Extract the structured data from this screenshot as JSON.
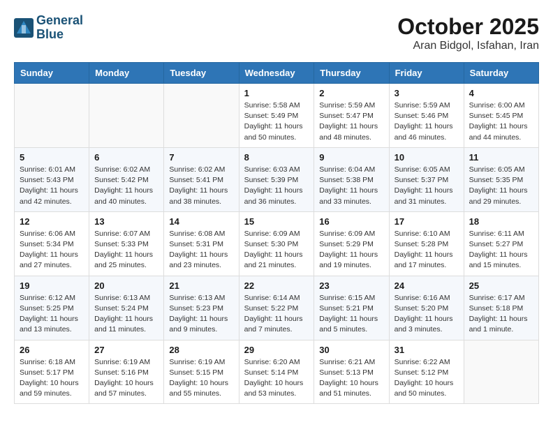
{
  "header": {
    "logo_line1": "General",
    "logo_line2": "Blue",
    "month": "October 2025",
    "location": "Aran Bidgol, Isfahan, Iran"
  },
  "weekdays": [
    "Sunday",
    "Monday",
    "Tuesday",
    "Wednesday",
    "Thursday",
    "Friday",
    "Saturday"
  ],
  "weeks": [
    [
      {
        "day": "",
        "info": ""
      },
      {
        "day": "",
        "info": ""
      },
      {
        "day": "",
        "info": ""
      },
      {
        "day": "1",
        "info": "Sunrise: 5:58 AM\nSunset: 5:49 PM\nDaylight: 11 hours\nand 50 minutes."
      },
      {
        "day": "2",
        "info": "Sunrise: 5:59 AM\nSunset: 5:47 PM\nDaylight: 11 hours\nand 48 minutes."
      },
      {
        "day": "3",
        "info": "Sunrise: 5:59 AM\nSunset: 5:46 PM\nDaylight: 11 hours\nand 46 minutes."
      },
      {
        "day": "4",
        "info": "Sunrise: 6:00 AM\nSunset: 5:45 PM\nDaylight: 11 hours\nand 44 minutes."
      }
    ],
    [
      {
        "day": "5",
        "info": "Sunrise: 6:01 AM\nSunset: 5:43 PM\nDaylight: 11 hours\nand 42 minutes."
      },
      {
        "day": "6",
        "info": "Sunrise: 6:02 AM\nSunset: 5:42 PM\nDaylight: 11 hours\nand 40 minutes."
      },
      {
        "day": "7",
        "info": "Sunrise: 6:02 AM\nSunset: 5:41 PM\nDaylight: 11 hours\nand 38 minutes."
      },
      {
        "day": "8",
        "info": "Sunrise: 6:03 AM\nSunset: 5:39 PM\nDaylight: 11 hours\nand 36 minutes."
      },
      {
        "day": "9",
        "info": "Sunrise: 6:04 AM\nSunset: 5:38 PM\nDaylight: 11 hours\nand 33 minutes."
      },
      {
        "day": "10",
        "info": "Sunrise: 6:05 AM\nSunset: 5:37 PM\nDaylight: 11 hours\nand 31 minutes."
      },
      {
        "day": "11",
        "info": "Sunrise: 6:05 AM\nSunset: 5:35 PM\nDaylight: 11 hours\nand 29 minutes."
      }
    ],
    [
      {
        "day": "12",
        "info": "Sunrise: 6:06 AM\nSunset: 5:34 PM\nDaylight: 11 hours\nand 27 minutes."
      },
      {
        "day": "13",
        "info": "Sunrise: 6:07 AM\nSunset: 5:33 PM\nDaylight: 11 hours\nand 25 minutes."
      },
      {
        "day": "14",
        "info": "Sunrise: 6:08 AM\nSunset: 5:31 PM\nDaylight: 11 hours\nand 23 minutes."
      },
      {
        "day": "15",
        "info": "Sunrise: 6:09 AM\nSunset: 5:30 PM\nDaylight: 11 hours\nand 21 minutes."
      },
      {
        "day": "16",
        "info": "Sunrise: 6:09 AM\nSunset: 5:29 PM\nDaylight: 11 hours\nand 19 minutes."
      },
      {
        "day": "17",
        "info": "Sunrise: 6:10 AM\nSunset: 5:28 PM\nDaylight: 11 hours\nand 17 minutes."
      },
      {
        "day": "18",
        "info": "Sunrise: 6:11 AM\nSunset: 5:27 PM\nDaylight: 11 hours\nand 15 minutes."
      }
    ],
    [
      {
        "day": "19",
        "info": "Sunrise: 6:12 AM\nSunset: 5:25 PM\nDaylight: 11 hours\nand 13 minutes."
      },
      {
        "day": "20",
        "info": "Sunrise: 6:13 AM\nSunset: 5:24 PM\nDaylight: 11 hours\nand 11 minutes."
      },
      {
        "day": "21",
        "info": "Sunrise: 6:13 AM\nSunset: 5:23 PM\nDaylight: 11 hours\nand 9 minutes."
      },
      {
        "day": "22",
        "info": "Sunrise: 6:14 AM\nSunset: 5:22 PM\nDaylight: 11 hours\nand 7 minutes."
      },
      {
        "day": "23",
        "info": "Sunrise: 6:15 AM\nSunset: 5:21 PM\nDaylight: 11 hours\nand 5 minutes."
      },
      {
        "day": "24",
        "info": "Sunrise: 6:16 AM\nSunset: 5:20 PM\nDaylight: 11 hours\nand 3 minutes."
      },
      {
        "day": "25",
        "info": "Sunrise: 6:17 AM\nSunset: 5:18 PM\nDaylight: 11 hours\nand 1 minute."
      }
    ],
    [
      {
        "day": "26",
        "info": "Sunrise: 6:18 AM\nSunset: 5:17 PM\nDaylight: 10 hours\nand 59 minutes."
      },
      {
        "day": "27",
        "info": "Sunrise: 6:19 AM\nSunset: 5:16 PM\nDaylight: 10 hours\nand 57 minutes."
      },
      {
        "day": "28",
        "info": "Sunrise: 6:19 AM\nSunset: 5:15 PM\nDaylight: 10 hours\nand 55 minutes."
      },
      {
        "day": "29",
        "info": "Sunrise: 6:20 AM\nSunset: 5:14 PM\nDaylight: 10 hours\nand 53 minutes."
      },
      {
        "day": "30",
        "info": "Sunrise: 6:21 AM\nSunset: 5:13 PM\nDaylight: 10 hours\nand 51 minutes."
      },
      {
        "day": "31",
        "info": "Sunrise: 6:22 AM\nSunset: 5:12 PM\nDaylight: 10 hours\nand 50 minutes."
      },
      {
        "day": "",
        "info": ""
      }
    ]
  ]
}
